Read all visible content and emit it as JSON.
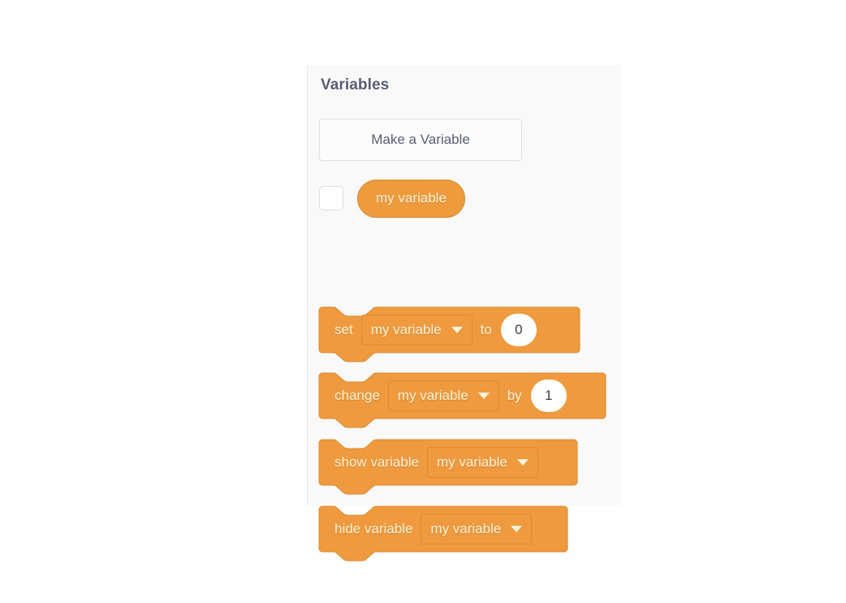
{
  "palette": {
    "category": "Variables",
    "background_color": "#f9f9f9",
    "block_color": "#ef9a3f",
    "block_border_color": "#dc8b30",
    "block_text_color": "#fdf3d8",
    "heading_color": "#575e75"
  },
  "buttons": {
    "make_variable": "Make a Variable"
  },
  "variables": [
    {
      "name": "my variable",
      "checked": false,
      "checkbox_name": "variable-visibility-checkbox"
    }
  ],
  "blocks": [
    {
      "id": "set",
      "opcode": "data_setvariableto",
      "parts": [
        {
          "type": "text",
          "value": "set"
        },
        {
          "type": "dropdown",
          "value": "my variable",
          "arrow": "chevron-down-icon"
        },
        {
          "type": "text",
          "value": "to"
        },
        {
          "type": "number",
          "value": "0"
        }
      ]
    },
    {
      "id": "change",
      "opcode": "data_changevariableby",
      "parts": [
        {
          "type": "text",
          "value": "change"
        },
        {
          "type": "dropdown",
          "value": "my variable",
          "arrow": "chevron-down-icon"
        },
        {
          "type": "text",
          "value": "by"
        },
        {
          "type": "number",
          "value": "1"
        }
      ]
    },
    {
      "id": "show",
      "opcode": "data_showvariable",
      "parts": [
        {
          "type": "text",
          "value": "show variable"
        },
        {
          "type": "dropdown",
          "value": "my variable",
          "arrow": "chevron-down-icon"
        }
      ]
    },
    {
      "id": "hide",
      "opcode": "data_hidevariable",
      "parts": [
        {
          "type": "text",
          "value": "hide variable"
        },
        {
          "type": "dropdown",
          "value": "my variable",
          "arrow": "chevron-down-icon"
        }
      ]
    }
  ]
}
